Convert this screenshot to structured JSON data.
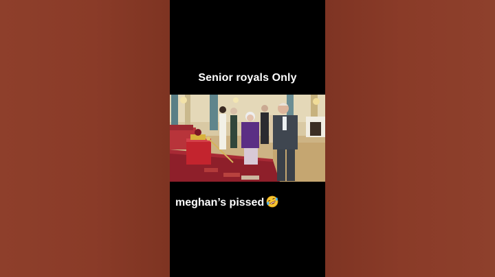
{
  "captions": {
    "top": "Senior royals Only",
    "bottom": "meghan’s pissed"
  },
  "emoji": {
    "name": "rolling-on-the-floor-laughing-icon",
    "glyph": "🤣"
  },
  "colors": {
    "side_panel": "#8a3b28",
    "video_background": "#000000",
    "caption_text": "#ffffff"
  }
}
